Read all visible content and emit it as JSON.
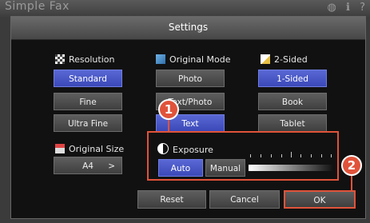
{
  "app": {
    "title": "Simple Fax",
    "icons": [
      "globe-icon",
      "info-icon",
      "help-icon"
    ]
  },
  "settings": {
    "title": "Settings",
    "resolution": {
      "label": "Resolution",
      "options": [
        "Standard",
        "Fine",
        "Ultra Fine"
      ],
      "selected": "Standard"
    },
    "original_mode": {
      "label": "Original Mode",
      "options": [
        "Photo",
        "Text/Photo",
        "Text"
      ],
      "selected": "Text"
    },
    "two_sided": {
      "label": "2-Sided",
      "options": [
        "1-Sided",
        "Book",
        "Tablet"
      ],
      "selected": "1-Sided"
    },
    "original_size": {
      "label": "Original Size",
      "value": "A4",
      "chevron": ">"
    },
    "exposure": {
      "label": "Exposure",
      "auto": "Auto",
      "manual": "Manual",
      "selected": "Auto"
    },
    "footer": {
      "reset": "Reset",
      "cancel": "Cancel",
      "ok": "OK"
    }
  },
  "callouts": {
    "one": "1",
    "two": "2"
  },
  "colors": {
    "accent": "#4653c4",
    "callout": "#e0533a"
  }
}
